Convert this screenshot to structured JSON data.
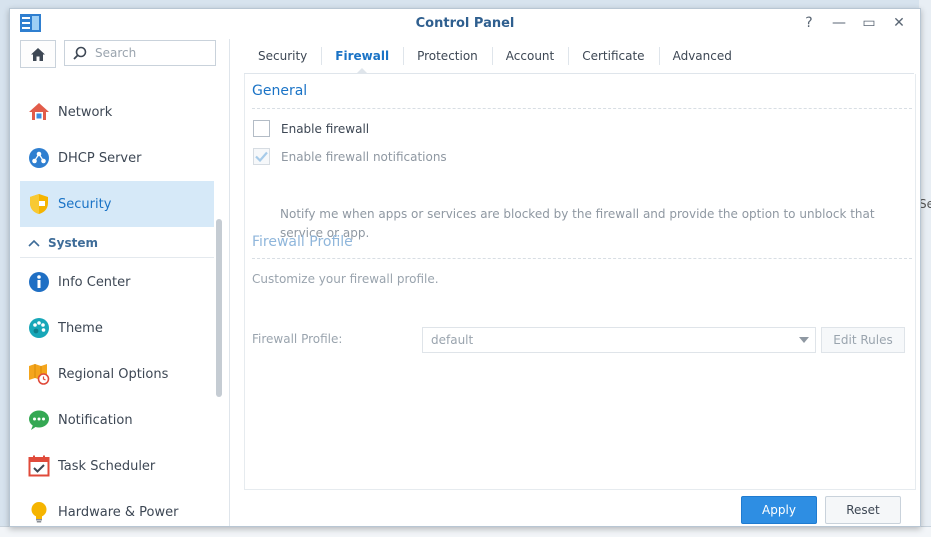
{
  "window": {
    "title": "Control Panel",
    "controls": {
      "help": "?",
      "minimize": "—",
      "maximize": "▭",
      "close": "✕"
    }
  },
  "desktop": {
    "edge_label": "Se"
  },
  "sidebar": {
    "search_placeholder": "Search",
    "items": [
      {
        "label": "Network",
        "icon": "network-icon",
        "active": false
      },
      {
        "label": "DHCP Server",
        "icon": "dhcp-server-icon",
        "active": false
      },
      {
        "label": "Security",
        "icon": "shield-icon",
        "active": true
      }
    ],
    "section": {
      "label": "System",
      "icon": "chevron-up-icon"
    },
    "system_items": [
      {
        "label": "Info Center",
        "icon": "info-icon"
      },
      {
        "label": "Theme",
        "icon": "palette-icon"
      },
      {
        "label": "Regional Options",
        "icon": "map-clock-icon"
      },
      {
        "label": "Notification",
        "icon": "chat-bubble-icon"
      },
      {
        "label": "Task Scheduler",
        "icon": "calendar-check-icon"
      },
      {
        "label": "Hardware & Power",
        "icon": "lightbulb-icon"
      }
    ]
  },
  "tabs": [
    {
      "label": "Security",
      "active": false
    },
    {
      "label": "Firewall",
      "active": true
    },
    {
      "label": "Protection",
      "active": false
    },
    {
      "label": "Account",
      "active": false
    },
    {
      "label": "Certificate",
      "active": false
    },
    {
      "label": "Advanced",
      "active": false
    }
  ],
  "general": {
    "title": "General",
    "enable_firewall": {
      "label": "Enable firewall",
      "checked": false
    },
    "enable_notifications": {
      "label": "Enable firewall notifications",
      "checked": true,
      "disabled": true
    },
    "notify_description": "Notify me when apps or services are blocked by the firewall and provide the option to unblock that service or app."
  },
  "profile": {
    "title": "Firewall Profile",
    "description": "Customize your firewall profile.",
    "field_label": "Firewall Profile:",
    "selected": "default",
    "edit_rules_label": "Edit Rules"
  },
  "footer": {
    "apply_label": "Apply",
    "reset_label": "Reset"
  },
  "colors": {
    "accent": "#1a73c6",
    "apply": "#2e8ee3",
    "active_bg": "#d6e9f8"
  }
}
